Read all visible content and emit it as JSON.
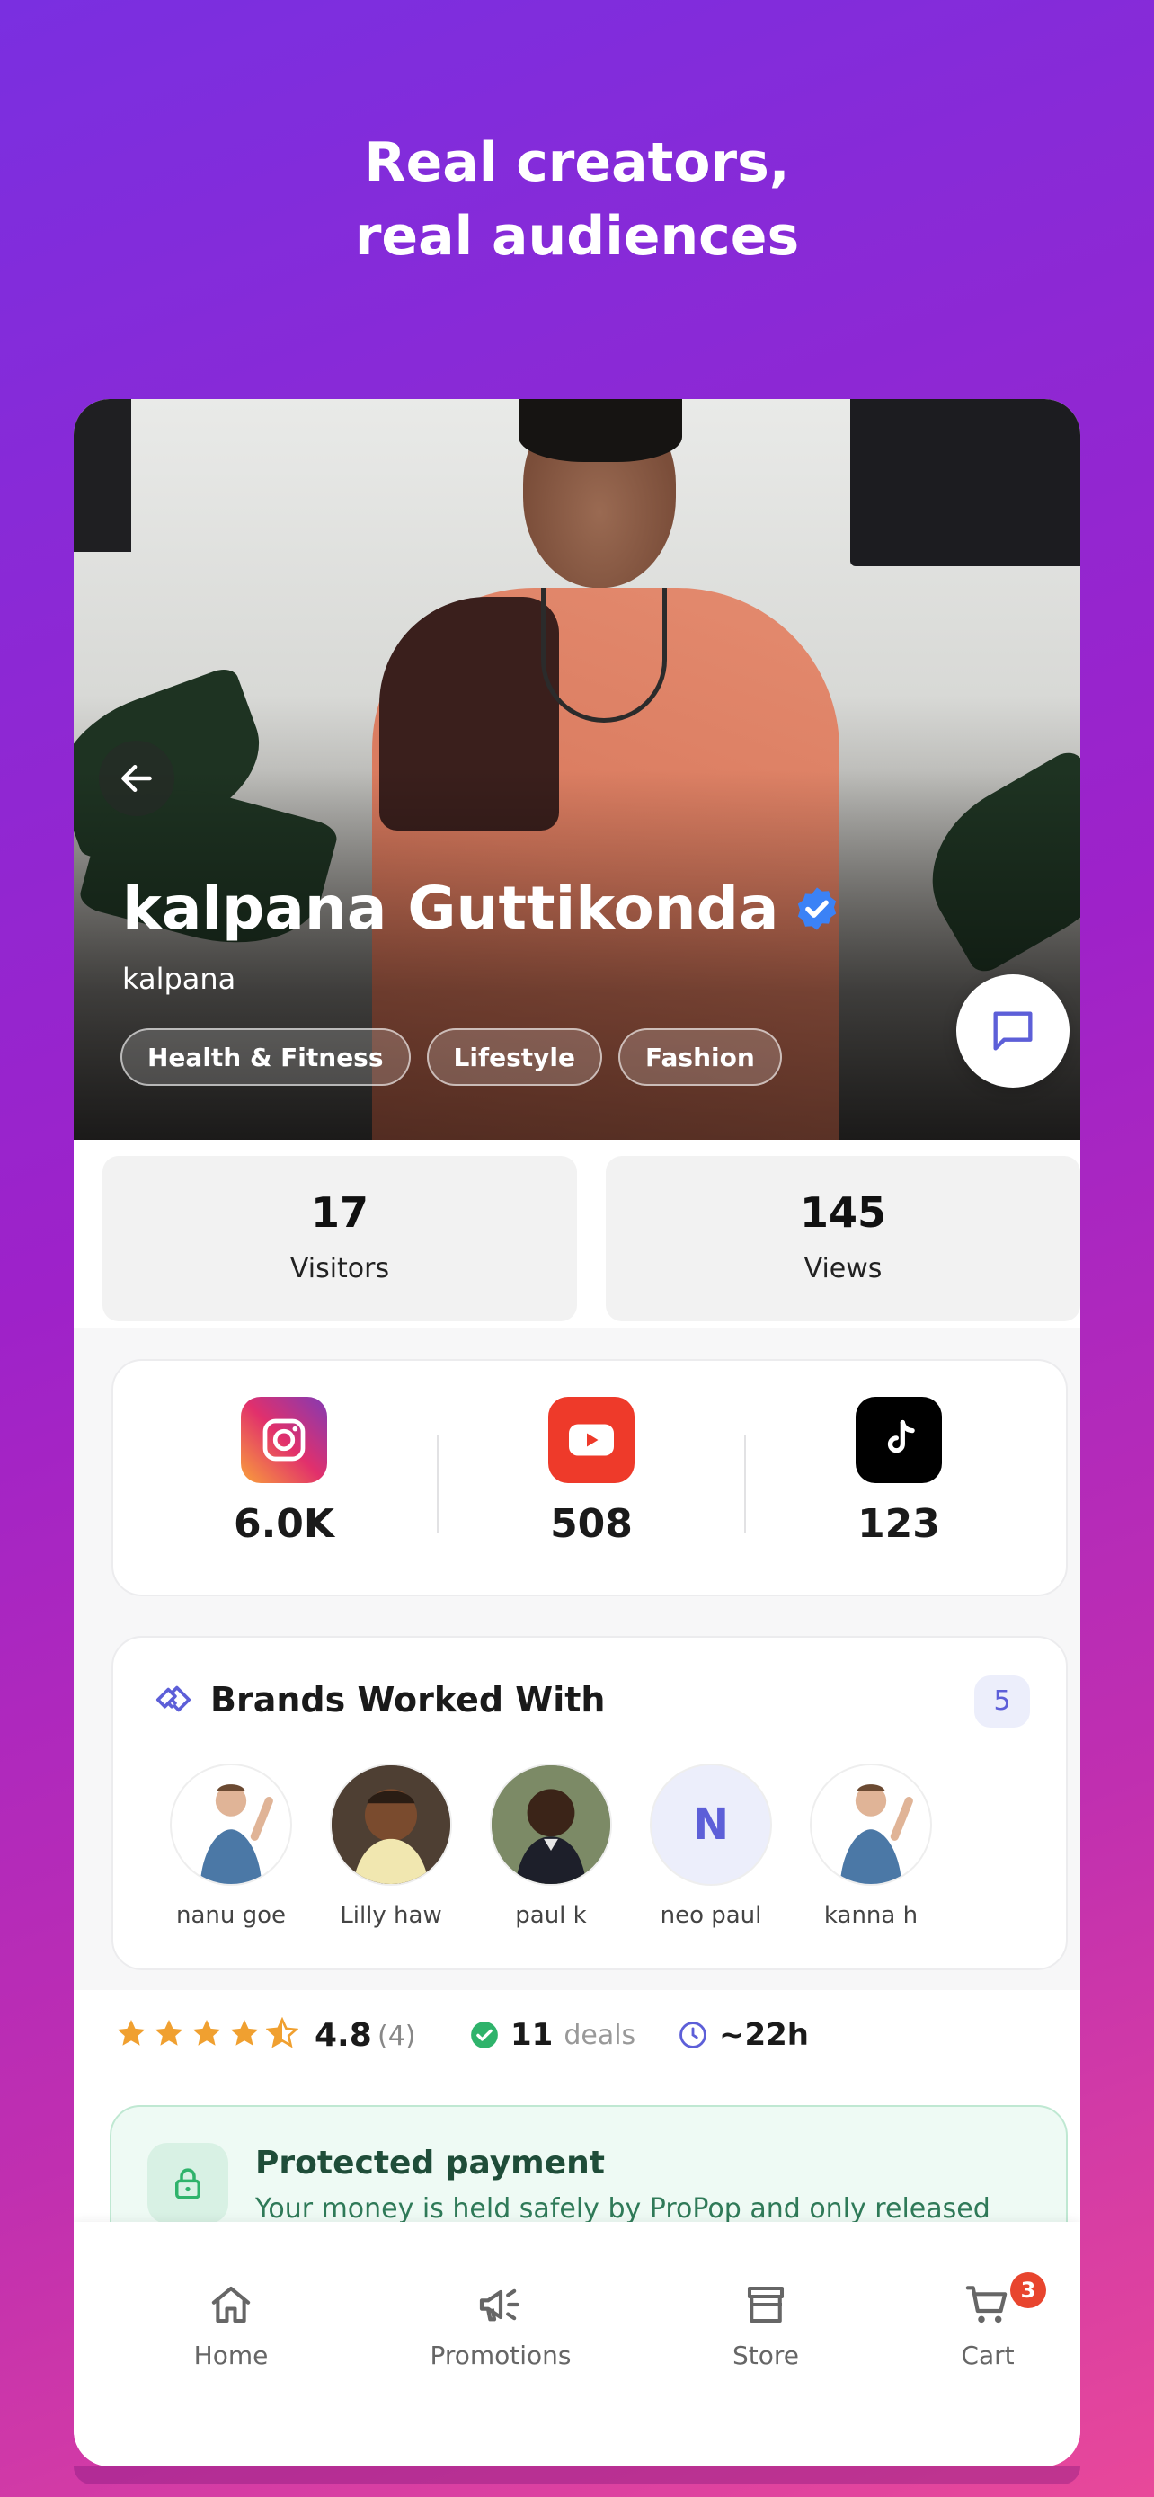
{
  "headline": {
    "line1": "Real creators,",
    "line2": "real audiences"
  },
  "profile": {
    "name": "kalpana Guttikonda",
    "handle": "kalpana",
    "verified": true,
    "tags": [
      "Health & Fitness",
      "Lifestyle",
      "Fashion"
    ]
  },
  "stats": [
    {
      "value": "17",
      "label": "Visitors"
    },
    {
      "value": "145",
      "label": "Views"
    }
  ],
  "social": [
    {
      "platform": "instagram-icon",
      "count": "6.0K"
    },
    {
      "platform": "youtube-icon",
      "count": "508"
    },
    {
      "platform": "tiktok-icon",
      "count": "123"
    }
  ],
  "brands": {
    "title": "Brands Worked With",
    "count": "5",
    "items": [
      {
        "name": "nanu goe",
        "avatar": "photo"
      },
      {
        "name": "Lilly  haw",
        "avatar": "photo"
      },
      {
        "name": "paul k",
        "avatar": "photo"
      },
      {
        "name": "neo paul",
        "avatar": "initial",
        "initial": "N"
      },
      {
        "name": "kanna h",
        "avatar": "photo"
      }
    ]
  },
  "rating": {
    "value": "4.8",
    "count": "(4)",
    "stars": 4.5,
    "deals_number": "11",
    "deals_label": "deals",
    "response_time": "~22h"
  },
  "protected": {
    "title": "Protected payment",
    "description": "Your money is held safely by ProPop and only released"
  },
  "nav": {
    "home": "Home",
    "promotions": "Promotions",
    "store": "Store",
    "cart": "Cart",
    "cart_badge": "3"
  },
  "colors": {
    "accent": "#5d5fd8",
    "verified": "#3b82f6",
    "star": "#f0a030",
    "success": "#2fb36b",
    "badge": "#e8452e"
  }
}
